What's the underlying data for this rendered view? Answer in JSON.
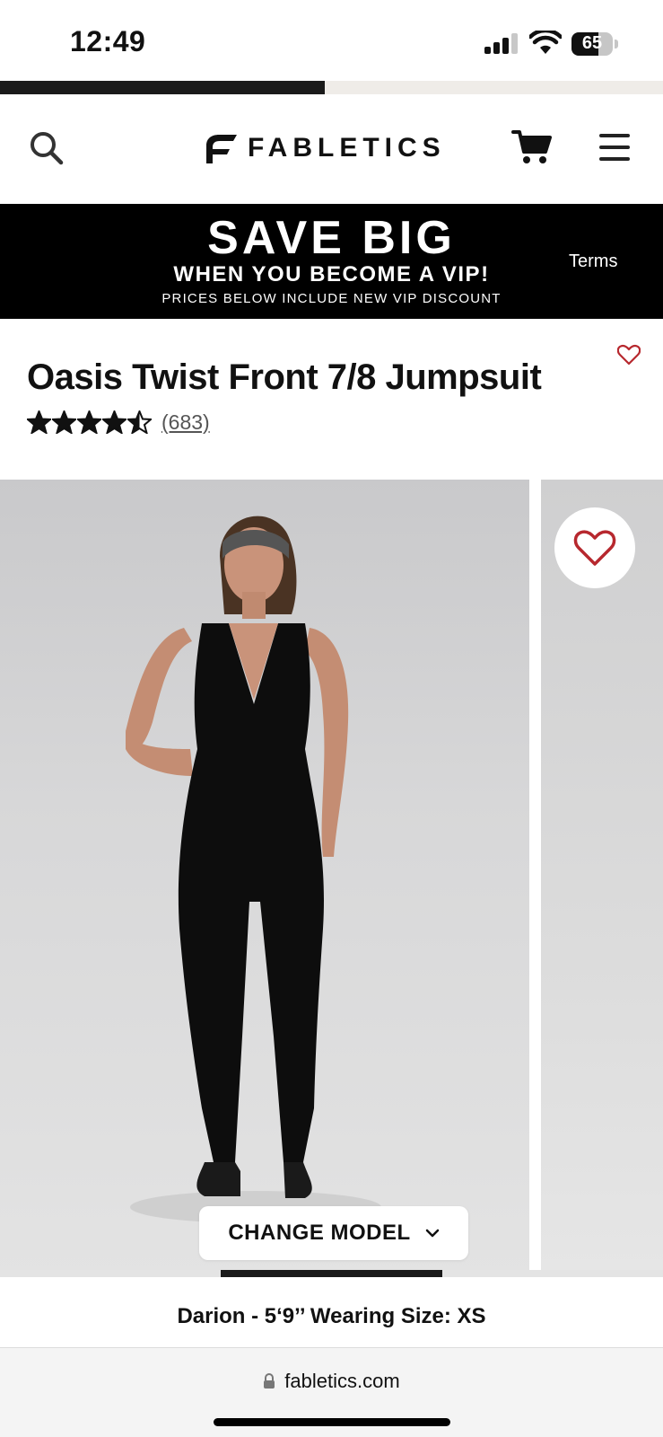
{
  "status_bar": {
    "time": "12:49",
    "battery": "65",
    "battery_level": 0.65
  },
  "progress": {
    "fill_fraction": 0.49
  },
  "header": {
    "logo_text": "FABLETICS",
    "icons": {
      "search": "search-icon",
      "cart": "cart-icon",
      "menu": "menu-icon"
    }
  },
  "promo": {
    "title": "SAVE BIG",
    "subtitle": "WHEN YOU BECOME A VIP!",
    "note": "PRICES BELOW INCLUDE NEW VIP DISCOUNT",
    "terms": "Terms"
  },
  "product": {
    "title": "Oasis Twist Front 7/8 Jumpsuit",
    "rating": 4.5,
    "review_count": "(683)"
  },
  "gallery": {
    "change_model_label": "CHANGE MODEL",
    "active_index": 1,
    "total_slides": 3
  },
  "model_caption": "Darion - 5‘9’’ Wearing Size: XS",
  "browser": {
    "url": "fabletics.com"
  },
  "colors": {
    "accent_heart": "#b7282e",
    "banner_bg": "#000000",
    "text": "#111111"
  }
}
